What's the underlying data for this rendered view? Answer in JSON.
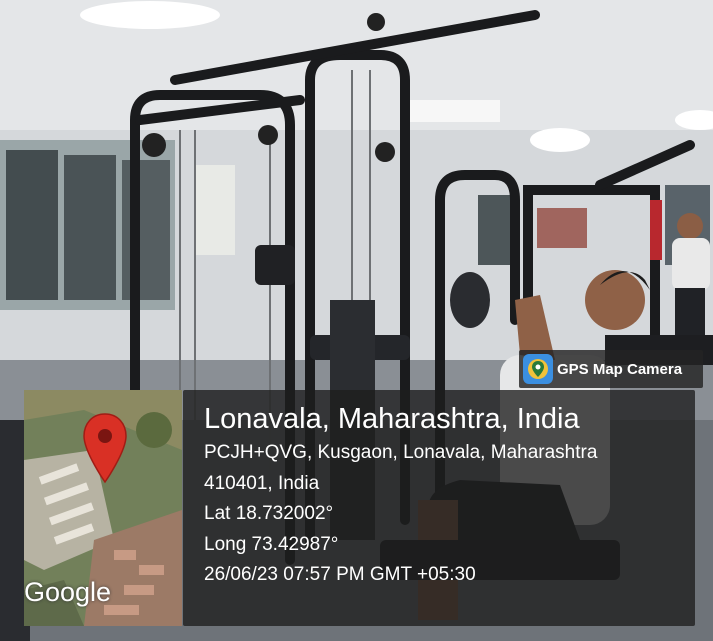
{
  "badge": {
    "app_name": "GPS Map Camera",
    "icon": "gps-map-camera-icon"
  },
  "map": {
    "watermark": "Google",
    "pin": "map-pin-icon",
    "pin_color": "#d93025"
  },
  "location": {
    "place": "Lonavala, Maharashtra, India",
    "address_line1": "PCJH+QVG, Kusgaon, Lonavala, Maharashtra",
    "address_line2": "410401, India",
    "latitude": "Lat 18.732002°",
    "longitude": "Long 73.42987°",
    "timestamp": "26/06/23 07:57 PM GMT +05:30"
  }
}
